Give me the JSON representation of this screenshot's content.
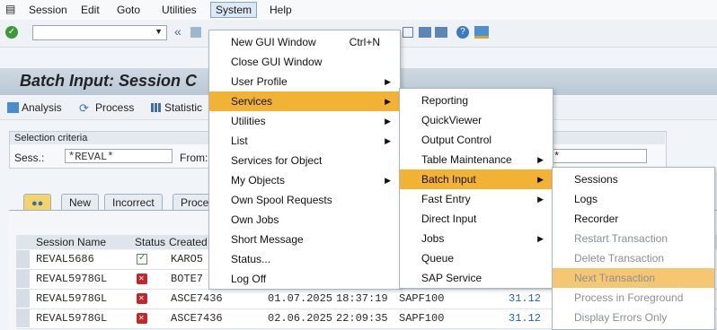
{
  "menubar": {
    "items": [
      "Session",
      "Edit",
      "Goto",
      "Utilities",
      "System",
      "Help"
    ]
  },
  "toolbar": {
    "back": "«"
  },
  "title": "Batch Input: Session C",
  "app_toolbar": {
    "analysis": "Analysis",
    "process": "Process",
    "statistics": "Statistic"
  },
  "selection": {
    "header": "Selection criteria",
    "sess_label": "Sess.:",
    "sess_value": "*REVAL*",
    "from_label": "From:",
    "right_value": "*"
  },
  "tabs": [
    "New",
    "Incorrect",
    "Proce"
  ],
  "table": {
    "columns": [
      "Session Name",
      "Status",
      "Created"
    ],
    "rows": [
      {
        "name": "REVAL5686",
        "status": "ok",
        "created": "KARO5",
        "date": "",
        "time": "",
        "user": "",
        "extra": ""
      },
      {
        "name": "REVAL5978GL",
        "status": "error",
        "created": "BOTE7",
        "date": "",
        "time": "",
        "user": "",
        "extra": ""
      },
      {
        "name": "REVAL5978GL",
        "status": "error",
        "created": "ASCE7436",
        "date": "01.07.2025",
        "time": "18:37:19",
        "user": "SAPF100",
        "extra": "31.12"
      },
      {
        "name": "REVAL5978GL",
        "status": "error",
        "created": "ASCE7436",
        "date": "02.06.2025",
        "time": "22:09:35",
        "user": "SAPF100",
        "extra": "31.12"
      }
    ]
  },
  "system_menu": [
    {
      "label": "New GUI Window",
      "accel": "Ctrl+N",
      "arrow": false
    },
    {
      "label": "Close GUI Window",
      "accel": "",
      "arrow": false
    },
    {
      "label": "User Profile",
      "accel": "",
      "arrow": true
    },
    {
      "label": "Services",
      "accel": "",
      "arrow": true,
      "highlight": true
    },
    {
      "label": "Utilities",
      "accel": "",
      "arrow": true
    },
    {
      "label": "List",
      "accel": "",
      "arrow": true
    },
    {
      "label": "Services for Object",
      "accel": "",
      "arrow": false
    },
    {
      "label": "My Objects",
      "accel": "",
      "arrow": true
    },
    {
      "label": "Own Spool Requests",
      "accel": "",
      "arrow": false
    },
    {
      "label": "Own Jobs",
      "accel": "",
      "arrow": false
    },
    {
      "label": "Short Message",
      "accel": "",
      "arrow": false
    },
    {
      "label": "Status...",
      "accel": "",
      "arrow": false
    },
    {
      "label": "Log Off",
      "accel": "",
      "arrow": false
    }
  ],
  "services_menu": [
    {
      "label": "Reporting",
      "arrow": false
    },
    {
      "label": "QuickViewer",
      "arrow": false
    },
    {
      "label": "Output Control",
      "arrow": false
    },
    {
      "label": "Table Maintenance",
      "arrow": true
    },
    {
      "label": "Batch Input",
      "arrow": true,
      "highlight": true
    },
    {
      "label": "Fast Entry",
      "arrow": true
    },
    {
      "label": "Direct Input",
      "arrow": false
    },
    {
      "label": "Jobs",
      "arrow": true
    },
    {
      "label": "Queue",
      "arrow": false
    },
    {
      "label": "SAP Service",
      "arrow": false
    }
  ],
  "batch_input_menu": [
    {
      "label": "Sessions",
      "disabled": false
    },
    {
      "label": "Logs",
      "disabled": false
    },
    {
      "label": "Recorder",
      "disabled": false
    },
    {
      "label": "Restart Transaction",
      "disabled": true
    },
    {
      "label": "Delete Transaction",
      "disabled": true
    },
    {
      "label": "Next Transaction",
      "disabled": true,
      "highlight": true
    },
    {
      "label": "Process in Foreground",
      "disabled": true
    },
    {
      "label": "Display Errors Only",
      "disabled": true
    }
  ],
  "colors": {
    "highlight": "#f2b233",
    "error": "#c0282d",
    "title_bg": "#c3d0dc"
  }
}
